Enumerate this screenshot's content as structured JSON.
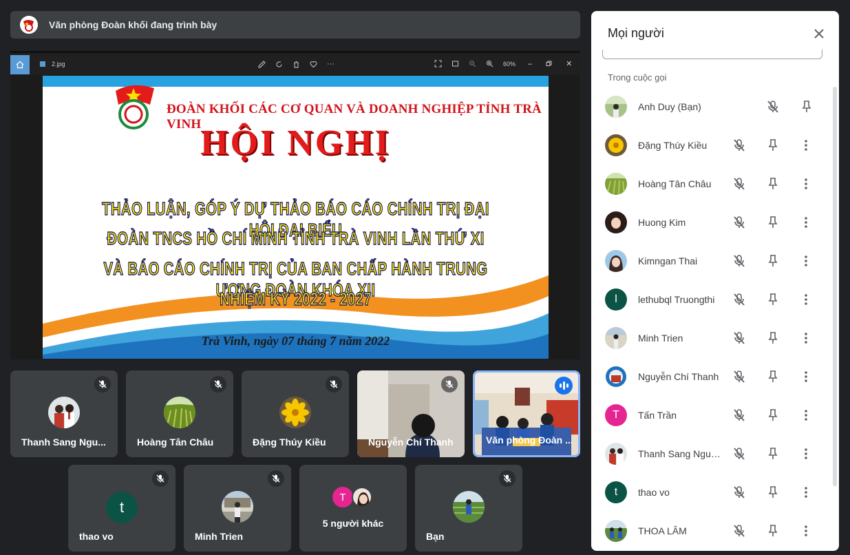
{
  "presenter": {
    "text": "Văn phòng Đoàn khối đang trình bày"
  },
  "viewer": {
    "file_name": "2.jpg",
    "zoom": "60%"
  },
  "slide": {
    "org": "ĐOÀN KHỐI CÁC CƠ QUAN VÀ DOANH NGHIỆP TỈNH TRÀ VINH",
    "title": "HỘI NGHỊ",
    "line1": "THẢO LUẬN, GÓP Ý DỰ THẢO BÁO CÁO CHÍNH TRỊ ĐẠI HỘI ĐẠI BIỂU",
    "line2": "ĐOÀN TNCS HỒ CHÍ MINH TỈNH TRÀ VINH LẦN THỨ XI",
    "line3": "VÀ BÁO CÁO CHÍNH TRỊ CỦA BAN CHẤP HÀNH TRUNG ƯƠNG ĐOÀN KHÓA XII",
    "line4": "NHIỆM KỲ 2022 - 2027",
    "date": "Trà Vinh, ngày 07 tháng 7 năm 2022"
  },
  "tiles": [
    {
      "name": "Thanh Sang Ngu..."
    },
    {
      "name": "Hoàng Tân Châu"
    },
    {
      "name": "Đặng Thúy Kiều"
    },
    {
      "name": "Nguyễn Chí Thanh"
    },
    {
      "name": "Văn phòng Đoàn ..."
    },
    {
      "name": "thao vo",
      "initial": "t"
    },
    {
      "name": "Minh Trien"
    },
    {
      "name": "5 người khác",
      "initial": "T"
    },
    {
      "name": "Bạn"
    }
  ],
  "panel": {
    "title": "Mọi người",
    "section": "Trong cuộc gọi",
    "people": [
      {
        "name": "Anh Duy (Bạn)"
      },
      {
        "name": "Đặng Thúy Kiều"
      },
      {
        "name": "Hoàng Tân Châu"
      },
      {
        "name": "Huong Kim"
      },
      {
        "name": "Kimngan Thai"
      },
      {
        "name": "lethubql Truongthi",
        "initial": "l"
      },
      {
        "name": "Minh Trien"
      },
      {
        "name": "Nguyễn Chí Thanh"
      },
      {
        "name": "Tấn Trần",
        "initial": "T"
      },
      {
        "name": "Thanh Sang Nguy..."
      },
      {
        "name": "thao vo",
        "initial": "t"
      },
      {
        "name": "THOA LÂM"
      }
    ]
  },
  "colors": {
    "accent": "#8ab4f8",
    "blue": "#1a73e8",
    "tile_bg": "#3c4043",
    "page_bg": "#202124"
  }
}
